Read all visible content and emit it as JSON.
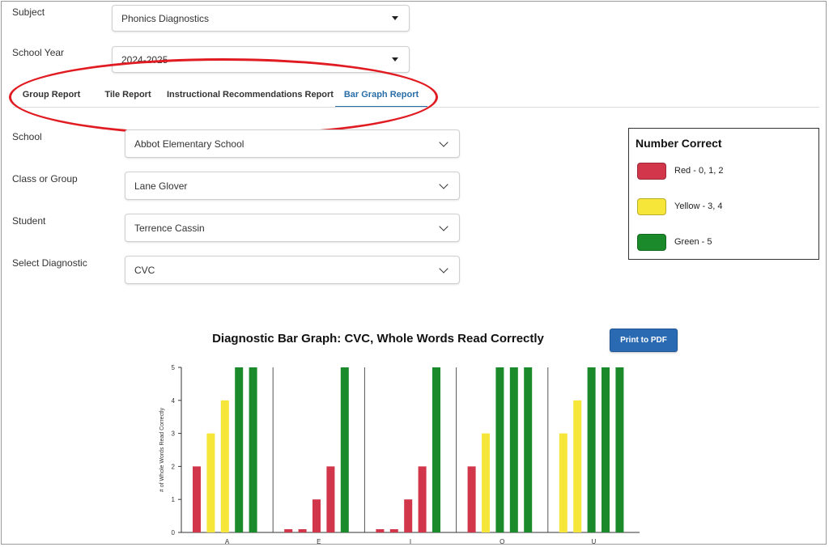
{
  "subject": {
    "label": "Subject",
    "value": "Phonics Diagnostics"
  },
  "school_year": {
    "label": "School Year",
    "value": "2024-2025"
  },
  "tabs": [
    {
      "label": "Group Report",
      "active": false
    },
    {
      "label": "Tile Report",
      "active": false
    },
    {
      "label": "Instructional Recommendations Report",
      "active": false
    },
    {
      "label": "Bar Graph Report",
      "active": true
    }
  ],
  "filters": {
    "school": {
      "label": "School",
      "value": "Abbot Elementary School"
    },
    "class_group": {
      "label": "Class or Group",
      "value": "Lane Glover"
    },
    "student": {
      "label": "Student",
      "value": "Terrence Cassin"
    },
    "diagnostic": {
      "label": "Select Diagnostic",
      "value": "CVC"
    }
  },
  "legend": {
    "title": "Number Correct",
    "items": [
      {
        "label": "Red - 0, 1, 2",
        "color": "#d1364b"
      },
      {
        "label": "Yellow - 3, 4",
        "color": "#f7e63a"
      },
      {
        "label": "Green - 5",
        "color": "#1a8a2a"
      }
    ]
  },
  "print_button": {
    "label": "Print to PDF"
  },
  "colors": {
    "red": "#d1364b",
    "yellow": "#f7e63a",
    "green": "#1a8a2a",
    "accent": "#2a6ea8",
    "highlight": "#e11b22"
  },
  "chart_data": {
    "type": "bar",
    "title": "Diagnostic Bar Graph: CVC, Whole Words Read Correctly",
    "ylabel": "# of Whole Words Read Correctly",
    "xlabel": "",
    "ylim": [
      0,
      5
    ],
    "yticks": [
      0,
      1,
      2,
      3,
      4,
      5
    ],
    "categories": [
      "A",
      "E",
      "I",
      "O",
      "U"
    ],
    "groups": [
      {
        "category": "A",
        "bars": [
          {
            "value": 2,
            "color": "red"
          },
          {
            "value": 3,
            "color": "yellow"
          },
          {
            "value": 4,
            "color": "yellow"
          },
          {
            "value": 5,
            "color": "green"
          },
          {
            "value": 5,
            "color": "green"
          }
        ]
      },
      {
        "category": "E",
        "bars": [
          {
            "value": 0,
            "color": "red"
          },
          {
            "value": 0,
            "color": "red"
          },
          {
            "value": 1,
            "color": "red"
          },
          {
            "value": 2,
            "color": "red"
          },
          {
            "value": 5,
            "color": "green"
          }
        ]
      },
      {
        "category": "I",
        "bars": [
          {
            "value": 0,
            "color": "red"
          },
          {
            "value": 0,
            "color": "red"
          },
          {
            "value": 1,
            "color": "red"
          },
          {
            "value": 2,
            "color": "red"
          },
          {
            "value": 5,
            "color": "green"
          }
        ]
      },
      {
        "category": "O",
        "bars": [
          {
            "value": 2,
            "color": "red"
          },
          {
            "value": 3,
            "color": "yellow"
          },
          {
            "value": 5,
            "color": "green"
          },
          {
            "value": 5,
            "color": "green"
          },
          {
            "value": 5,
            "color": "green"
          }
        ]
      },
      {
        "category": "U",
        "bars": [
          {
            "value": 3,
            "color": "yellow"
          },
          {
            "value": 4,
            "color": "yellow"
          },
          {
            "value": 5,
            "color": "green"
          },
          {
            "value": 5,
            "color": "green"
          },
          {
            "value": 5,
            "color": "green"
          }
        ]
      }
    ],
    "grid": false,
    "legend_position": "top-right"
  }
}
